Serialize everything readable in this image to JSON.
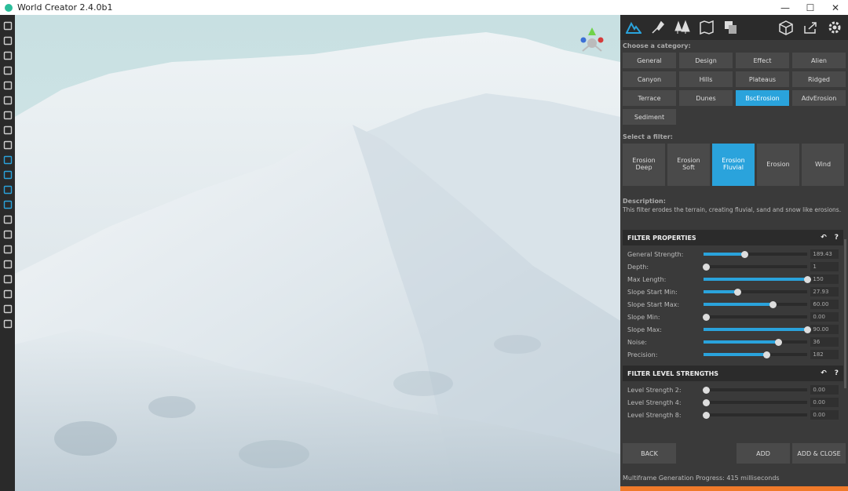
{
  "window": {
    "title": "World Creator 2.4.0b1",
    "min_label": "—",
    "max_label": "☐",
    "close_label": "✕"
  },
  "left_toolbar": [
    "new-file-icon",
    "open-folder-icon",
    "open-recent-icon",
    "save-icon",
    "save-as-icon",
    "export-icon",
    "map-icon",
    "binoculars-icon",
    "globe-icon",
    "terrain-icon",
    "brush-icon",
    "trees-icon",
    "grass-icon",
    "river-icon",
    "road-icon",
    "network-icon",
    "grid-icon",
    "image-icon",
    "sun-icon",
    "star-icon",
    "tool-icon"
  ],
  "panel": {
    "top_tabs": [
      "terrain-tab-icon",
      "brush-tab-icon",
      "trees-tab-icon",
      "map-tab-icon",
      "layers-tab-icon"
    ],
    "top_right": [
      "cube-icon",
      "share-icon",
      "settings-icon"
    ],
    "category_label": "Choose a category:",
    "categories": [
      "General",
      "Design",
      "Effect",
      "Alien",
      "Canyon",
      "Hills",
      "Plateaus",
      "Ridged",
      "Terrace",
      "Dunes",
      "BscErosion",
      "AdvErosion",
      "Sediment"
    ],
    "active_category": "BscErosion",
    "filter_label": "Select a filter:",
    "filters": [
      "Erosion\nDeep",
      "Erosion\nSoft",
      "Erosion\nFluvial",
      "Erosion",
      "Wind"
    ],
    "active_filter": "Erosion\nFluvial",
    "description_label": "Description:",
    "description": "This filter erodes the terrain, creating fluvial, sand and snow like erosions.",
    "filter_properties": {
      "header": "FILTER PROPERTIES",
      "back_icon": "↶",
      "help_icon": "?",
      "rows": [
        {
          "label": "General Strength:",
          "value": "189.43",
          "level": 0.4
        },
        {
          "label": "Depth:",
          "value": "1",
          "level": 0.03
        },
        {
          "label": "Max Length:",
          "value": "150",
          "level": 1.0
        },
        {
          "label": "Slope Start Min:",
          "value": "27.93",
          "level": 0.33
        },
        {
          "label": "Slope Start Max:",
          "value": "60.00",
          "level": 0.67
        },
        {
          "label": "Slope Min:",
          "value": "0.00",
          "level": 0.03
        },
        {
          "label": "Slope Max:",
          "value": "90.00",
          "level": 1.0
        },
        {
          "label": "Noise:",
          "value": "36",
          "level": 0.72
        },
        {
          "label": "Precision:",
          "value": "182",
          "level": 0.61
        }
      ]
    },
    "filter_levels": {
      "header": "FILTER LEVEL STRENGTHS",
      "back_icon": "↶",
      "help_icon": "?",
      "rows": [
        {
          "label": "Level Strength 2:",
          "value": "0.00",
          "level": 0.03
        },
        {
          "label": "Level Strength 4:",
          "value": "0.00",
          "level": 0.03
        },
        {
          "label": "Level Strength 8:",
          "value": "0.00",
          "level": 0.03
        }
      ]
    },
    "buttons": {
      "back": "BACK",
      "add": "ADD",
      "add_close": "ADD & CLOSE"
    },
    "progress_text": "Multiframe Generation Progress: 415 milliseconds",
    "progress": 1.0
  },
  "colors": {
    "accent": "#2aa3dc",
    "progress": "#f07a2a"
  }
}
